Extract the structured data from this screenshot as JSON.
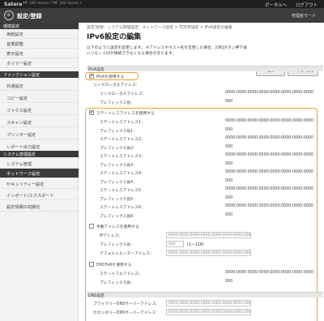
{
  "top": {
    "brand": "Satera",
    "model": "MF 240 Series / MF 240 Series /",
    "portal": "ポータルへ",
    "logout": "ログアウト"
  },
  "header": {
    "title": "設定/登録",
    "admin": "管理者モード"
  },
  "sidebar": {
    "cat1": "環境設定",
    "items1": [
      "用紙設定",
      "音量調整",
      "表示設定",
      "タイマー設定"
    ],
    "cat2": "ファンクション設定",
    "items2": [
      "共通設定",
      "コピー設定",
      "ファクス設定",
      "スキャン設定",
      "プリンター設定",
      "レポート出力設定"
    ],
    "cat3": "システム管理設定",
    "items3": [
      "システム管理",
      "ネットワーク設定",
      "セキュリティー設定",
      "インポート/エクスポート",
      "設定情報の初期化"
    ]
  },
  "main": {
    "breadcrumb": "設定/登録：システム管理設定：ネットワーク設定 > TCP/IP設定 > IPv6設定の編集",
    "title": "IPv6設定の編集",
    "desc": "以下のように設定を変更します。 ※アドレスやホスト名を変更した場合、[OK]ボタン押下後にリモートUIが接続できなくなる場合があります。",
    "ok": "OK",
    "cancel": "キャンセル",
    "ipv6_section": "IPv6設定",
    "use_ipv6": "IPv6を使用する",
    "link_local_header": "リンクローカルアドレス：",
    "link_local_label": "リンクローカルアドレス：",
    "link_local_value": "0000:0000:0000:0000:0000:0000:0000:0000",
    "link_prefix_label": "プレフィックス長：",
    "link_prefix_value": "000",
    "use_stateless": "ステートレスアドレスを使用する",
    "stateless": [
      {
        "addr_label": "ステートレスアドレス1：",
        "addr": "0000:0000:0000:0000:0000:0000:0000:0000",
        "prefix_label": "プレフィックス長1：",
        "prefix": "000"
      },
      {
        "addr_label": "ステートレスアドレス2：",
        "addr": "0000:0000:0000:0000:0000:0000:0000:0000",
        "prefix_label": "プレフィックス長2：",
        "prefix": "000"
      },
      {
        "addr_label": "ステートレスアドレス3：",
        "addr": "0000:0000:0000:0000:0000:0000:0000:0000",
        "prefix_label": "プレフィックス長3：",
        "prefix": "000"
      },
      {
        "addr_label": "ステートレスアドレス4：",
        "addr": "0000:0000:0000:0000:0000:0000:0000:0000",
        "prefix_label": "プレフィックス長4：",
        "prefix": "000"
      },
      {
        "addr_label": "ステートレスアドレス5：",
        "addr": "0000:0000:0000:0000:0000:0000:0000:0000",
        "prefix_label": "プレフィックス長5：",
        "prefix": "000"
      },
      {
        "addr_label": "ステートレスアドレス6：",
        "addr": "0000:0000:0000:0000:0000:0000:0000:0000",
        "prefix_label": "プレフィックス長6：",
        "prefix": "000"
      }
    ],
    "use_manual": "手動アドレスを使用する",
    "manual_ip_label": "IPアドレス：",
    "manual_ip_value": "0000:0000:0000:0000:0000:0000:0000:0000",
    "manual_prefix_label": "プレフィックス長：",
    "manual_prefix_value": "064",
    "manual_prefix_hint": "(1〜128)",
    "manual_gw_label": "デフォルトルーターアドレス：",
    "manual_gw_value": "0000:0000:0000:0000:0000:0000:0000:0000",
    "use_dhcp": "DHCPv6を使用する",
    "dhcp_addr_label": "ステートフルアドレス：",
    "dhcp_addr_value": "0000:0000:0000:0000:0000:0000:0000:0000",
    "dhcp_prefix_label": "プレフィックス長：",
    "dhcp_prefix_value": "000",
    "dns_section": "DNS設定",
    "dns_primary_label": "プライマリーDNSサーバーアドレス：",
    "dns_primary_value": "0000:0000:0000:0000:0000:0000:0000:0000",
    "dns_secondary_label": "セカンダリーDNSサーバーアドレス：",
    "dns_secondary_value": "0000:0000:0000:0000:0000:0000:0000:0000",
    "checked_mark": "✔",
    "highlight_color": "#f0a030"
  }
}
